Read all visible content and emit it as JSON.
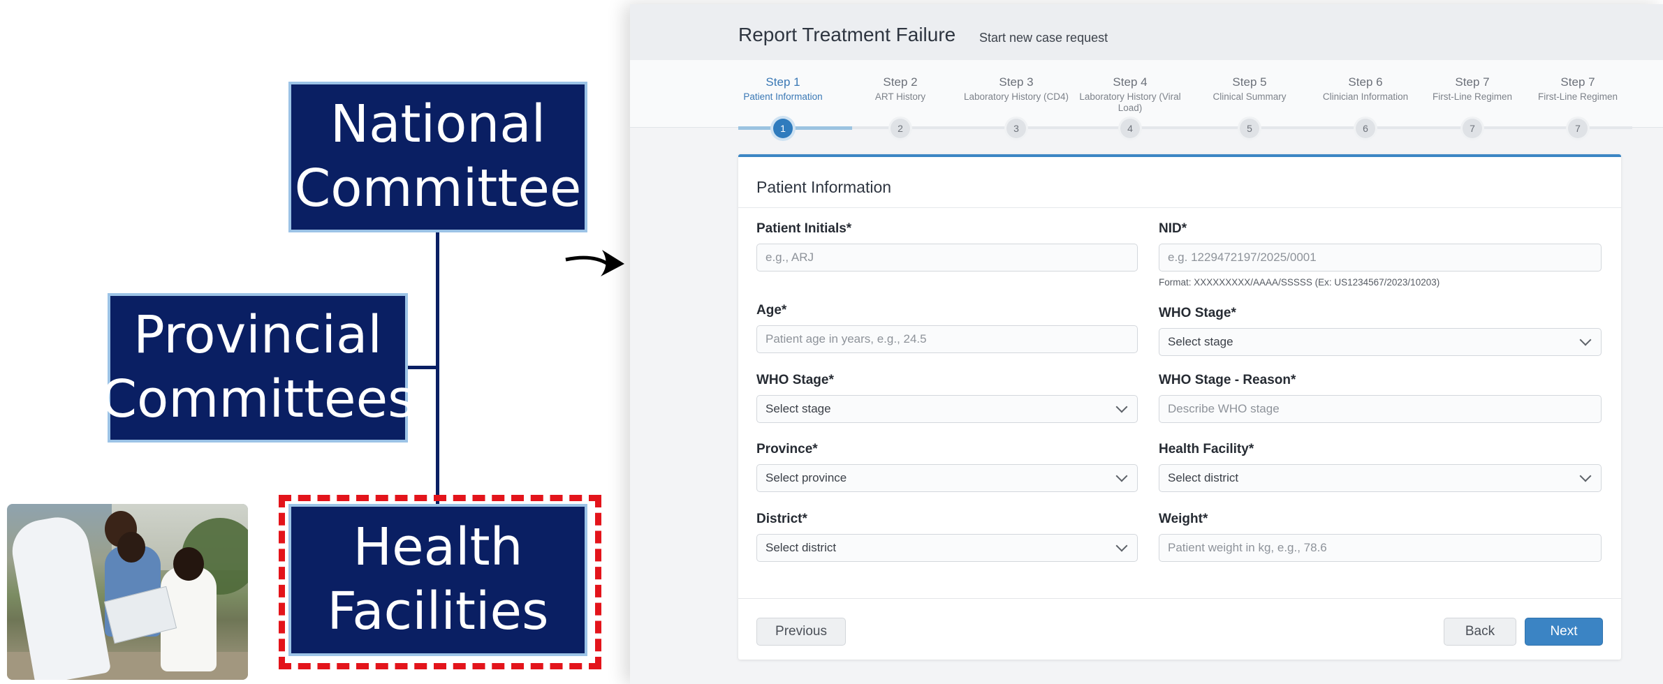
{
  "org_chart": {
    "national": "National\nCommittee",
    "provincial": "Provincial\nCommittees",
    "facilities": "Health\nFacilities"
  },
  "colors": {
    "box_fill": "#0a1f63",
    "box_border": "#9cc3e6",
    "highlight": "#e3141b",
    "accent": "#3b84c4"
  },
  "app": {
    "title": "Report Treatment Failure",
    "subtitle": "Start new case request"
  },
  "steps": [
    {
      "title": "Step 1",
      "label": "Patient Information",
      "num": "1"
    },
    {
      "title": "Step 2",
      "label": "ART History",
      "num": "2"
    },
    {
      "title": "Step 3",
      "label": "Laboratory History (CD4)",
      "num": "3"
    },
    {
      "title": "Step 4",
      "label": "Laboratory History (Viral Load)",
      "num": "4"
    },
    {
      "title": "Step 5",
      "label": "Clinical Summary",
      "num": "5"
    },
    {
      "title": "Step 6",
      "label": "Clinician Information",
      "num": "6"
    },
    {
      "title": "Step 7",
      "label": "First-Line Regimen",
      "num": "7"
    },
    {
      "title": "Step 7",
      "label": "First-Line Regimen",
      "num": "7"
    }
  ],
  "form": {
    "section_title": "Patient Information",
    "patient_initials": {
      "label": "Patient Initials*",
      "placeholder": "e.g., ARJ"
    },
    "nid": {
      "label": "NID*",
      "placeholder": "e.g. 1229472197/2025/0001",
      "help": "Format: XXXXXXXXX/AAAA/SSSSS (Ex: US1234567/2023/10203)"
    },
    "age": {
      "label": "Age*",
      "placeholder": "Patient age in years, e.g., 24.5"
    },
    "who_stage_right": {
      "label": "WHO Stage*",
      "value": "Select stage"
    },
    "who_stage_left": {
      "label": "WHO Stage*",
      "value": "Select stage"
    },
    "who_stage_reason": {
      "label": "WHO Stage - Reason*",
      "placeholder": "Describe WHO stage"
    },
    "province": {
      "label": "Province*",
      "value": "Select province"
    },
    "health_facility": {
      "label": "Health Facility*",
      "value": "Select district"
    },
    "district": {
      "label": "District*",
      "value": "Select district"
    },
    "weight": {
      "label": "Weight*",
      "placeholder": "Patient weight in kg, e.g., 78.6"
    }
  },
  "buttons": {
    "previous": "Previous",
    "back": "Back",
    "next": "Next"
  }
}
